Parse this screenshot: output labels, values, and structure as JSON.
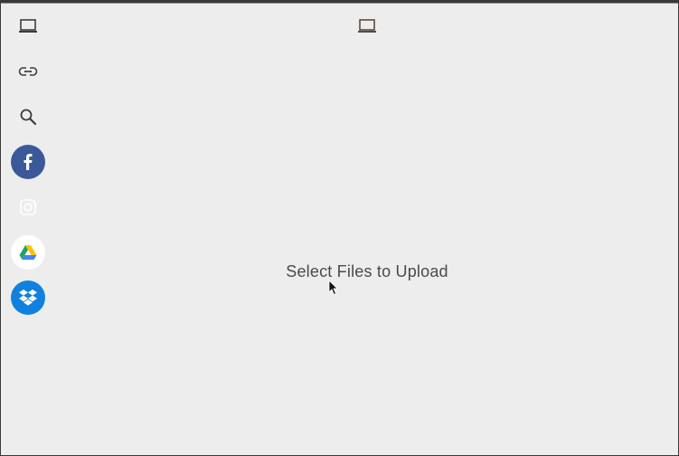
{
  "sources": [
    {
      "name": "My Device",
      "icon": "laptop-icon"
    },
    {
      "name": "Link",
      "icon": "link-icon"
    },
    {
      "name": "Web Search",
      "icon": "search-icon"
    },
    {
      "name": "Facebook",
      "icon": "facebook-icon",
      "color": "#3b5998"
    },
    {
      "name": "Instagram",
      "icon": "instagram-icon"
    },
    {
      "name": "Google Drive",
      "icon": "google-drive-icon"
    },
    {
      "name": "Dropbox",
      "icon": "dropbox-icon",
      "color": "#1081de"
    }
  ],
  "main": {
    "active_source_icon": "laptop-icon",
    "drop_label": "Select Files to Upload"
  }
}
